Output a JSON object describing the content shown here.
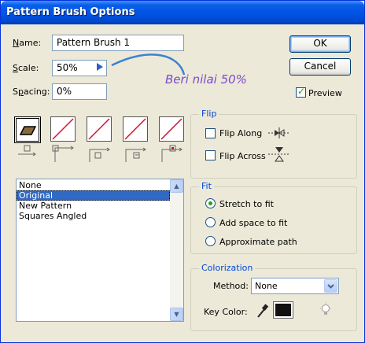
{
  "window": {
    "title": "Pattern Brush Options"
  },
  "form": {
    "name_label": "Name:",
    "name_value": "Pattern Brush 1",
    "scale_label": "Scale:",
    "scale_value": "50%",
    "spacing_label": "Spacing:",
    "spacing_value": "0%"
  },
  "annotation": {
    "text": "Beri nilai 50%"
  },
  "buttons": {
    "ok": "OK",
    "cancel": "Cancel"
  },
  "preview": {
    "label": "Preview",
    "checked": true
  },
  "pattern_list": {
    "items": [
      "None",
      "Original",
      "New Pattern",
      "Squares Angled"
    ],
    "selected": "Original"
  },
  "flip": {
    "title": "Flip",
    "along_label": "Flip Along",
    "across_label": "Flip Across"
  },
  "fit": {
    "title": "Fit",
    "options": [
      "Stretch to fit",
      "Add space to fit",
      "Approximate path"
    ],
    "selected": "Stretch to fit"
  },
  "colorization": {
    "title": "Colorization",
    "method_label": "Method:",
    "method_value": "None",
    "key_color_label": "Key Color:"
  },
  "icons": [
    "eyedropper-icon",
    "key-color-swatch",
    "lightbulb-tips-icon",
    "flip-along-icon",
    "flip-across-icon",
    "tile-side-icon",
    "tile-outer-corner-icon",
    "tile-inner-corner-icon",
    "tile-start-icon",
    "tile-end-icon"
  ]
}
